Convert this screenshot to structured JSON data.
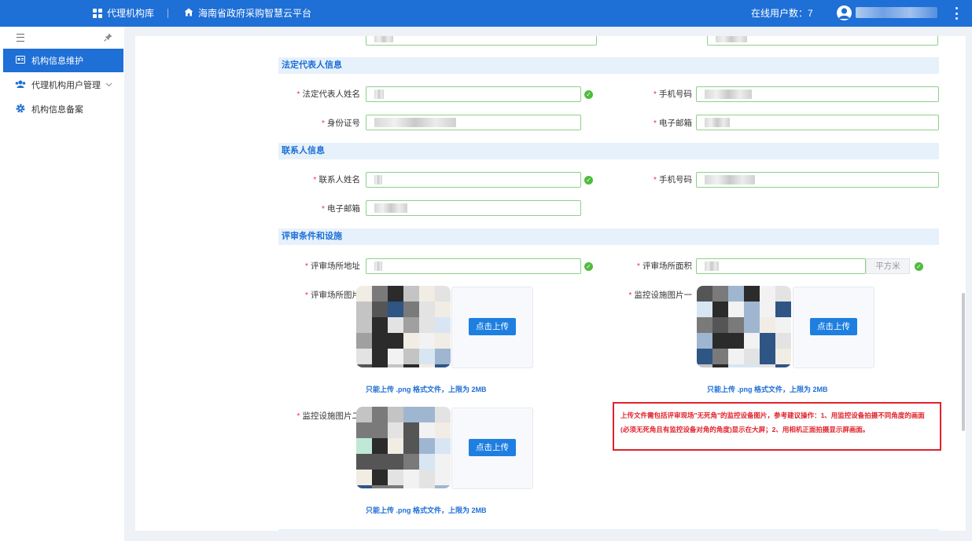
{
  "topbar": {
    "app_label": "代理机构库",
    "platform_label": "海南省政府采购智慧云平台",
    "online_label": "在线用户数：",
    "online_count": "7"
  },
  "sidebar": {
    "items": [
      {
        "label": "机构信息维护",
        "icon": "id-card-icon",
        "active": true
      },
      {
        "label": "代理机构用户管理",
        "icon": "users-icon",
        "active": false
      },
      {
        "label": "机构信息备案",
        "icon": "gear-icon",
        "active": false
      }
    ]
  },
  "sections": {
    "legal": "法定代表人信息",
    "contact": "联系人信息",
    "review": "评审条件和设施"
  },
  "fields": {
    "legal_name": "法定代表人姓名",
    "legal_phone": "手机号码",
    "legal_id": "身份证号",
    "legal_email": "电子邮箱",
    "contact_name": "联系人姓名",
    "contact_phone": "手机号码",
    "contact_email": "电子邮箱",
    "venue_address": "评审场所地址",
    "venue_area": "评审场所面积",
    "area_unit": "平方米",
    "venue_photo": "评审场所图片",
    "monitor_photo_1": "监控设施图片一",
    "monitor_photo_2": "监控设施图片二"
  },
  "upload": {
    "button": "点击上传",
    "hint": "只能上传 .png 格式文件，上限为 2MB"
  },
  "warning": "上传文件需包括评审现场\"无死角\"的监控设备图片，参考建议操作：1、用监控设备拍摄不同角度的画面(必须无死角且有监控设备对角的角度)显示在大屏；2、用相机正面拍摄显示屏画面。",
  "colors": {
    "primary": "#1e6fd6",
    "section_bg": "#e6f1fb",
    "valid_border": "#8fd08a",
    "success": "#4fbb3f",
    "warning": "#e0222b"
  }
}
